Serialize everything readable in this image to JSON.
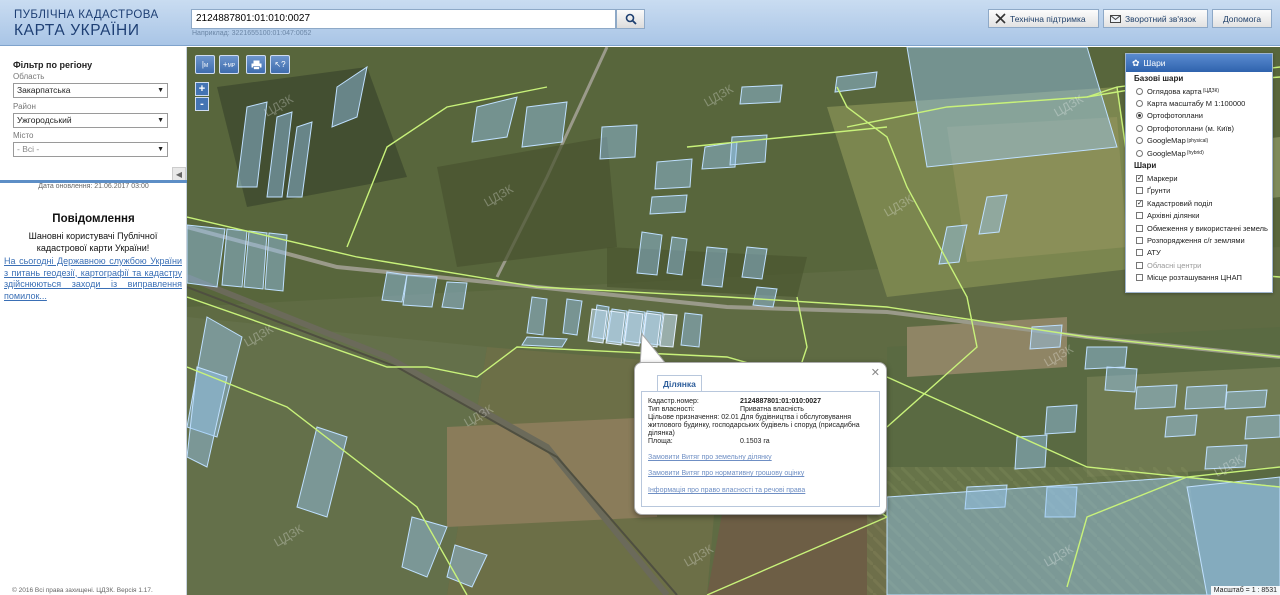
{
  "header": {
    "logo_line1": "ПУБЛІЧНА КАДАСТРОВА",
    "logo_line2": "КАРТА УКРАЇНИ",
    "search_value": "2124887801:01:010:0027",
    "search_hint": "Наприклад: 3221655100:01:047:0052",
    "btn_support": "Технічна підтримка",
    "btn_feedback": "Зворотний зв'язок",
    "btn_help": "Допомога"
  },
  "sidebar": {
    "filter_title": "Фільтр по регіону",
    "region_label": "Область",
    "region_value": "Закарпатська",
    "district_label": "Район",
    "district_value": "Ужгородський",
    "city_label": "Місто",
    "city_value": "- Всі -",
    "update_date": "Дата оновлення: 21.06.2017 03:00",
    "news_title": "Повідомлення",
    "news_body": "Шановні користувачі Публічної кадастрової карти України!",
    "news_link": "На сьогодні Державною службою України з питань геодезії, картографії та кадастру здійснюються заходи із виправлення помилок...",
    "copyright": "© 2016 Всі права захищені. ЦДЗК. Версія 1.17."
  },
  "toolbar": {
    "measure_label": "M",
    "measure_area_label": "MP",
    "zoom_in": "+",
    "zoom_out": "-"
  },
  "layers": {
    "title": "Шари",
    "base_title": "Базові шари",
    "base": [
      {
        "label": "Оглядова карта",
        "sup": "(ЦДЗК)",
        "on": false
      },
      {
        "label": "Карта масштабу М 1:100000",
        "sup": "",
        "on": false
      },
      {
        "label": "Ортофотоплани",
        "sup": "",
        "on": true
      },
      {
        "label": "Ортофотоплани (м. Київ)",
        "sup": "",
        "on": false
      },
      {
        "label": "GoogleMap",
        "sup": "(physical)",
        "on": false
      },
      {
        "label": "GoogleMap",
        "sup": "(hybrid)",
        "on": false
      }
    ],
    "overlay_title": "Шари",
    "overlays": [
      {
        "label": "Маркери",
        "on": true,
        "dim": false
      },
      {
        "label": "Ґрунти",
        "on": false,
        "dim": false
      },
      {
        "label": "Кадастровий поділ",
        "on": true,
        "dim": false
      },
      {
        "label": "Архівні ділянки",
        "on": false,
        "dim": false
      },
      {
        "label": "Обмеження у використанні земель",
        "on": false,
        "dim": false
      },
      {
        "label": "Розпорядження с/г землями",
        "on": false,
        "dim": false
      },
      {
        "label": "АТУ",
        "on": false,
        "dim": false
      },
      {
        "label": "Обласні центри",
        "on": false,
        "dim": true
      },
      {
        "label": "Місце розташування ЦНАП",
        "on": false,
        "dim": false
      }
    ]
  },
  "popup": {
    "tab": "Ділянка",
    "cadastral_label": "Кадастр.номер:",
    "cadastral_value": "2124887801:01:010:0027",
    "ownership_label": "Тип власності:",
    "ownership_value": "Приватна власність",
    "purpose_label": "Цільове призначення:",
    "purpose_value": "02.01 Для будівництва і обслуговування житлового будинку, господарських будівель і споруд (присадибна ділянка)",
    "area_label": "Площа:",
    "area_value": "0.1503 га",
    "link1": "Замовити Витяг про земельну ділянку",
    "link2": "Замовити Витяг про нормативну грошову оцінку",
    "link3": "Інформація про право власності та речові права"
  },
  "map": {
    "scale": "Масштаб = 1 : 8531",
    "watermark": "ЦДЗК"
  }
}
